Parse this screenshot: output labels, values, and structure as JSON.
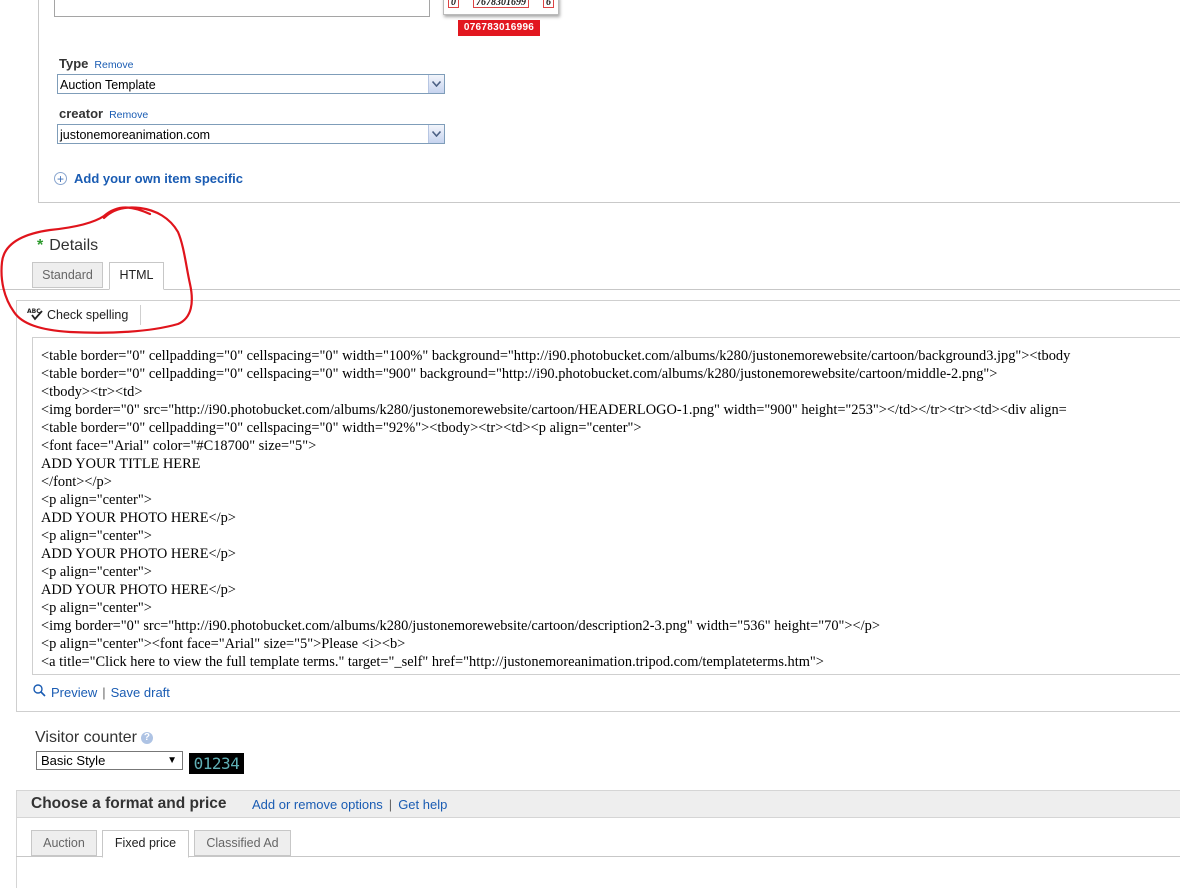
{
  "barcode": {
    "digits": [
      "0",
      "76783016996",
      "6"
    ],
    "digits_display": [
      "0",
      "7678301699",
      "6"
    ],
    "badge": "076783016996"
  },
  "specifics": {
    "type": {
      "label": "Type",
      "remove": "Remove",
      "value": "Auction Template"
    },
    "creator": {
      "label": "creator",
      "remove": "Remove",
      "value": "justonemoreanimation.com"
    },
    "add_own": "Add your own item specific"
  },
  "details": {
    "title": "Details",
    "required_mark": "*",
    "tabs": [
      {
        "label": "Standard",
        "active": false
      },
      {
        "label": "HTML",
        "active": true
      }
    ],
    "toolbar": {
      "check_spelling": "Check spelling"
    },
    "code_lines": [
      "<table border=\"0\" cellpadding=\"0\" cellspacing=\"0\" width=\"100%\" background=\"http://i90.photobucket.com/albums/k280/justonemorewebsite/cartoon/background3.jpg\"><tbody",
      "<table border=\"0\" cellpadding=\"0\" cellspacing=\"0\" width=\"900\" background=\"http://i90.photobucket.com/albums/k280/justonemorewebsite/cartoon/middle-2.png\">",
      "<tbody><tr><td>",
      "<img border=\"0\" src=\"http://i90.photobucket.com/albums/k280/justonemorewebsite/cartoon/HEADERLOGO-1.png\" width=\"900\" height=\"253\"></td></tr><tr><td><div align=",
      "<table border=\"0\" cellpadding=\"0\" cellspacing=\"0\" width=\"92%\"><tbody><tr><td><p align=\"center\">",
      "<font face=\"Arial\" color=\"#C18700\" size=\"5\">",
      "ADD YOUR TITLE HERE",
      "</font></p>",
      "<p align=\"center\">",
      "ADD YOUR PHOTO HERE</p>",
      "<p align=\"center\">",
      "ADD YOUR PHOTO HERE</p>",
      "<p align=\"center\">",
      "ADD YOUR PHOTO HERE</p>",
      "<p align=\"center\">",
      "<img border=\"0\" src=\"http://i90.photobucket.com/albums/k280/justonemorewebsite/cartoon/description2-3.png\" width=\"536\" height=\"70\"></p>",
      "<p align=\"center\"><font face=\"Arial\" size=\"5\">Please <i><b>",
      "<a title=\"Click here to view the full template terms.\" target=\"_self\" href=\"http://justonemoreanimation.tripod.com/templateterms.htm\">"
    ],
    "preview": "Preview",
    "save_draft": "Save draft"
  },
  "visitor_counter": {
    "label": "Visitor counter",
    "selected": "Basic Style",
    "preview_digits": "01234"
  },
  "format": {
    "title": "Choose a format and price",
    "add_remove": "Add or remove options",
    "get_help": "Get help",
    "tabs": [
      {
        "label": "Auction",
        "active": false
      },
      {
        "label": "Fixed price",
        "active": true
      },
      {
        "label": "Classified Ad",
        "active": false
      }
    ]
  },
  "colors": {
    "link": "#1a5cb3",
    "annotation": "#e0141c",
    "badge": "#e2171f",
    "required": "#2c9a2c"
  },
  "icons": {
    "add": "plus-circle-icon",
    "spell": "spellcheck-icon",
    "preview": "magnifier-icon",
    "help": "question-icon",
    "select": "chevron-down-icon"
  }
}
